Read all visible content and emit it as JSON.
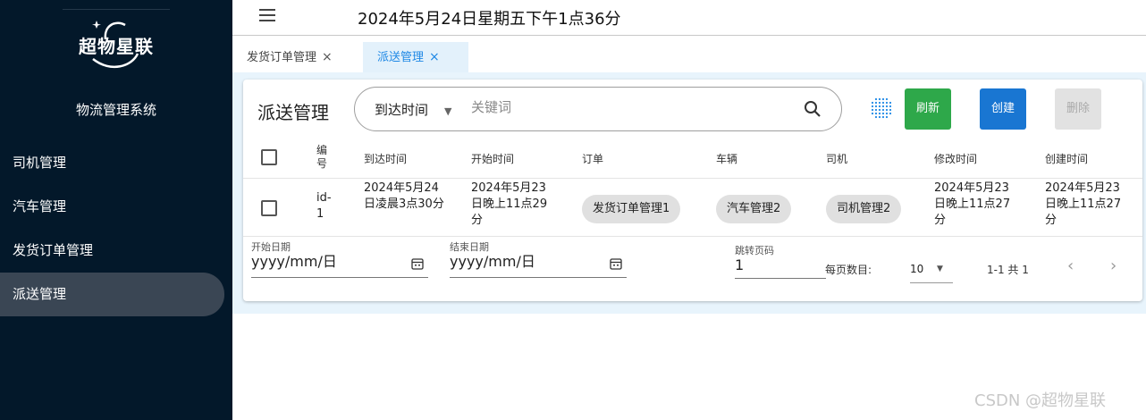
{
  "sidebar": {
    "logo_text": "超物星联",
    "system_title": "物流管理系统",
    "items": [
      {
        "label": "司机管理"
      },
      {
        "label": "汽车管理"
      },
      {
        "label": "发货订单管理"
      },
      {
        "label": "派送管理"
      }
    ],
    "active_item": "派送管理",
    "background": "#03182a"
  },
  "topbar": {
    "clock": "2024年5月24日星期五下午1点36分"
  },
  "tabs": [
    {
      "label": "发货订单管理",
      "close": "×"
    },
    {
      "label": "派送管理",
      "close": "×"
    }
  ],
  "card": {
    "title": "派送管理",
    "search": {
      "field": "到达时间",
      "placeholder": "关键词"
    },
    "buttons": {
      "refresh": "刷新",
      "create": "创建",
      "delete": "删除"
    },
    "colors": {
      "refresh": "#2ea84a",
      "create": "#1976d2",
      "delete": "#e2e2e2"
    }
  },
  "table": {
    "headers": {
      "id": "编号",
      "arrival": "到达时间",
      "start": "开始时间",
      "order": "订单",
      "vehicle": "车辆",
      "driver": "司机",
      "modified": "修改时间",
      "created": "创建时间"
    },
    "rows": [
      {
        "id": "id-1",
        "arrival": "2024年5月24日凌晨3点30分",
        "start": "2024年5月23日晚上11点29分",
        "order": "发货订单管理1",
        "vehicle": "汽车管理2",
        "driver": "司机管理2",
        "modified": "2024年5月23日晚上11点27分",
        "created": "2024年5月23日晚上11点27分"
      }
    ]
  },
  "footer": {
    "start_date_label": "开始日期",
    "start_date_value": "yyyy/mm/日",
    "end_date_label": "结束日期",
    "end_date_value": "yyyy/mm/日",
    "jump_label": "跳转页码",
    "jump_value": "1",
    "per_page_label": "每页数目:",
    "per_page_value": "10",
    "range": "1-1 共 1",
    "prev": "‹",
    "next": "›"
  },
  "watermark": "CSDN @超物星联"
}
